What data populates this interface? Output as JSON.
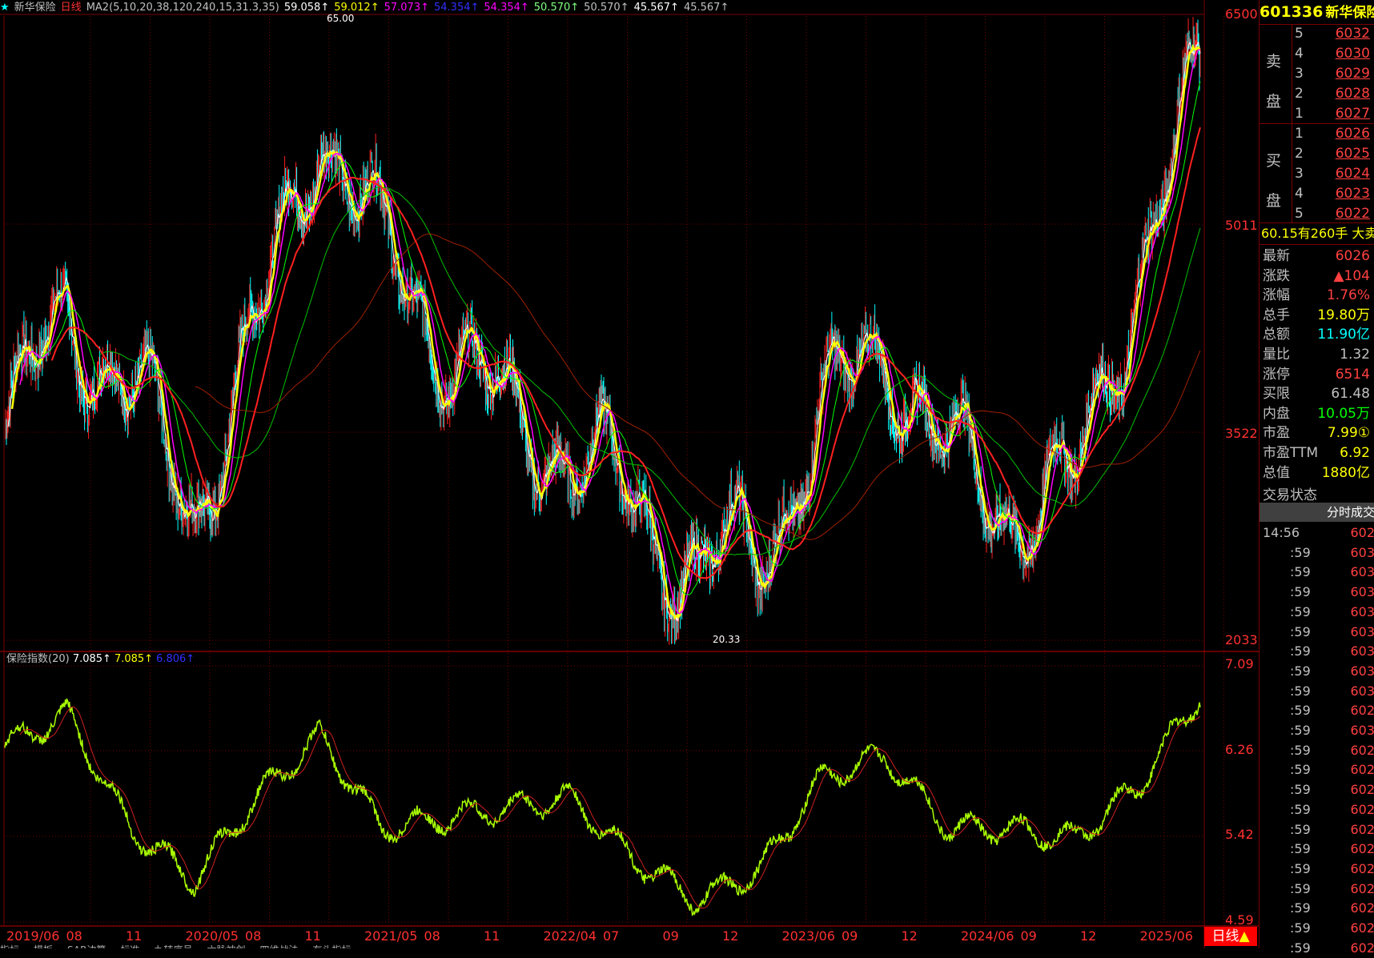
{
  "header": {
    "title": "新华保险",
    "period": "日线",
    "indicator": "MA2(5,10,20,38,120,240,15,31.3,35)",
    "ma_values": [
      {
        "text": "59.058↑",
        "color": "#ffffff"
      },
      {
        "text": "59.012↑",
        "color": "#ffff00"
      },
      {
        "text": "57.073↑",
        "color": "#ff00ff"
      },
      {
        "text": "54.354↑",
        "color": "#3030ff"
      },
      {
        "text": "54.354↑",
        "color": "#ff00ff"
      },
      {
        "text": "50.570↑",
        "color": "#80ff80"
      },
      {
        "text": "50.570↑",
        "color": "#c0c0c0"
      },
      {
        "text": "45.567↑",
        "color": "#ffffff"
      },
      {
        "text": "45.567↑",
        "color": "#c0c0c0"
      }
    ]
  },
  "main_axis": {
    "labels": [
      "6500",
      "5011",
      "3522",
      "2033"
    ]
  },
  "annotations": {
    "high": "65.00",
    "low": "20.33"
  },
  "sub": {
    "title": "保险指数(20)",
    "values": [
      {
        "text": "7.085↑",
        "color": "#ffffff"
      },
      {
        "text": "7.085↑",
        "color": "#ffff00"
      },
      {
        "text": "6.806↑",
        "color": "#3030ff"
      }
    ],
    "axis_labels": [
      "7.09",
      "6.26",
      "5.42",
      "4.59"
    ]
  },
  "dates": [
    "2019/06",
    "08",
    "11",
    "2020/05",
    "08",
    "11",
    "2021/05",
    "08",
    "11",
    "2022/04",
    "07",
    "09",
    "12",
    "2023/06",
    "09",
    "12",
    "2024/06",
    "09",
    "12",
    "2025/06"
  ],
  "period_label": "日线",
  "right_panel": {
    "code": "601336",
    "name": "新华保险",
    "sell_label": [
      "卖",
      "盘"
    ],
    "buy_label": [
      "买",
      "盘"
    ],
    "asks": [
      {
        "level": "5",
        "price": "6032"
      },
      {
        "level": "4",
        "price": "6030"
      },
      {
        "level": "3",
        "price": "6029"
      },
      {
        "level": "2",
        "price": "6028"
      },
      {
        "level": "1",
        "price": "6027"
      }
    ],
    "bids": [
      {
        "level": "1",
        "price": "6026"
      },
      {
        "level": "2",
        "price": "6025"
      },
      {
        "level": "3",
        "price": "6024"
      },
      {
        "level": "4",
        "price": "6023"
      },
      {
        "level": "5",
        "price": "6022"
      }
    ],
    "note": "60.15有260手 大卖",
    "stats": [
      {
        "label": "最新",
        "value": "6026",
        "color": "#ff4040"
      },
      {
        "label": "涨跌",
        "value": "▲104",
        "color": "#ff4040"
      },
      {
        "label": "涨幅",
        "value": "1.76%",
        "color": "#ff4040"
      },
      {
        "label": "总手",
        "value": "19.80万",
        "color": "#ffff00"
      },
      {
        "label": "总额",
        "value": "11.90亿",
        "color": "#00ffff"
      },
      {
        "label": "量比",
        "value": "1.32",
        "color": "#c0c0c0"
      },
      {
        "label": "涨停",
        "value": "6514",
        "color": "#ff4040"
      },
      {
        "label": "买限",
        "value": "61.48",
        "color": "#c0c0c0"
      },
      {
        "label": "内盘",
        "value": "10.05万",
        "color": "#00ff00"
      },
      {
        "label": "市盈",
        "value": "7.99①",
        "color": "#ffff00"
      },
      {
        "label": "市盈TTM",
        "value": "6.92",
        "color": "#ffff00"
      },
      {
        "label": "总值",
        "value": "1880亿",
        "color": "#ffff00"
      }
    ],
    "status_label": "交易状态",
    "tab_label": "分时成交",
    "ticks": [
      {
        "t": "14:56",
        "p": "602"
      },
      {
        "t": ":59",
        "p": "603"
      },
      {
        "t": ":59",
        "p": "603"
      },
      {
        "t": ":59",
        "p": "603"
      },
      {
        "t": ":59",
        "p": "603"
      },
      {
        "t": ":59",
        "p": "603"
      },
      {
        "t": ":59",
        "p": "603"
      },
      {
        "t": ":59",
        "p": "603"
      },
      {
        "t": ":59",
        "p": "603"
      },
      {
        "t": ":59",
        "p": "602"
      },
      {
        "t": ":59",
        "p": "603"
      },
      {
        "t": ":59",
        "p": "602"
      },
      {
        "t": ":59",
        "p": "602"
      },
      {
        "t": ":59",
        "p": "602"
      },
      {
        "t": ":59",
        "p": "602"
      },
      {
        "t": ":59",
        "p": "602"
      },
      {
        "t": ":59",
        "p": "602"
      },
      {
        "t": ":59",
        "p": "602"
      },
      {
        "t": ":59",
        "p": "602"
      },
      {
        "t": ":59",
        "p": "602"
      },
      {
        "t": ":59",
        "p": "602"
      },
      {
        "t": ":59",
        "p": "602"
      }
    ]
  },
  "bottom_tabs": [
    "指标",
    "模板",
    "SAR边算",
    "标准",
    "九转序号",
    "六脉神剑",
    "四维战法",
    "有头指标"
  ],
  "chart_data": {
    "type": "line",
    "title": "新华保险 日线",
    "ylim": [
      20.33,
      65.0
    ],
    "x": [
      "2019/06",
      "08",
      "11",
      "2020/05",
      "08",
      "11",
      "2021/05",
      "08",
      "11",
      "2022/04",
      "07",
      "09",
      "12",
      "2023/06",
      "09",
      "12",
      "2024/06",
      "09",
      "12",
      "2025/06"
    ],
    "series": [
      {
        "name": "MA",
        "values": [
          35,
          44,
          38,
          30,
          42,
          58,
          48,
          42,
          36,
          34,
          30,
          25,
          27,
          36,
          42,
          33,
          30,
          31,
          47,
          60
        ]
      }
    ],
    "sub_series": [
      {
        "name": "保险指数(20)",
        "values": [
          6.3,
          6.6,
          5.5,
          5.0,
          5.8,
          6.4,
          5.5,
          5.6,
          5.7,
          5.8,
          5.2,
          4.8,
          5.1,
          6.0,
          6.2,
          5.5,
          5.5,
          5.4,
          5.9,
          6.8
        ]
      }
    ]
  },
  "colors": {
    "grid": "#7a0000",
    "up": "#ff2020",
    "down": "#00ffff",
    "ma5": "#ffffff",
    "ma10": "#ffff00",
    "ma20": "#ff00ff",
    "ma38": "#00ff00",
    "ma120": "#00c000",
    "ma240": "#a02000"
  }
}
